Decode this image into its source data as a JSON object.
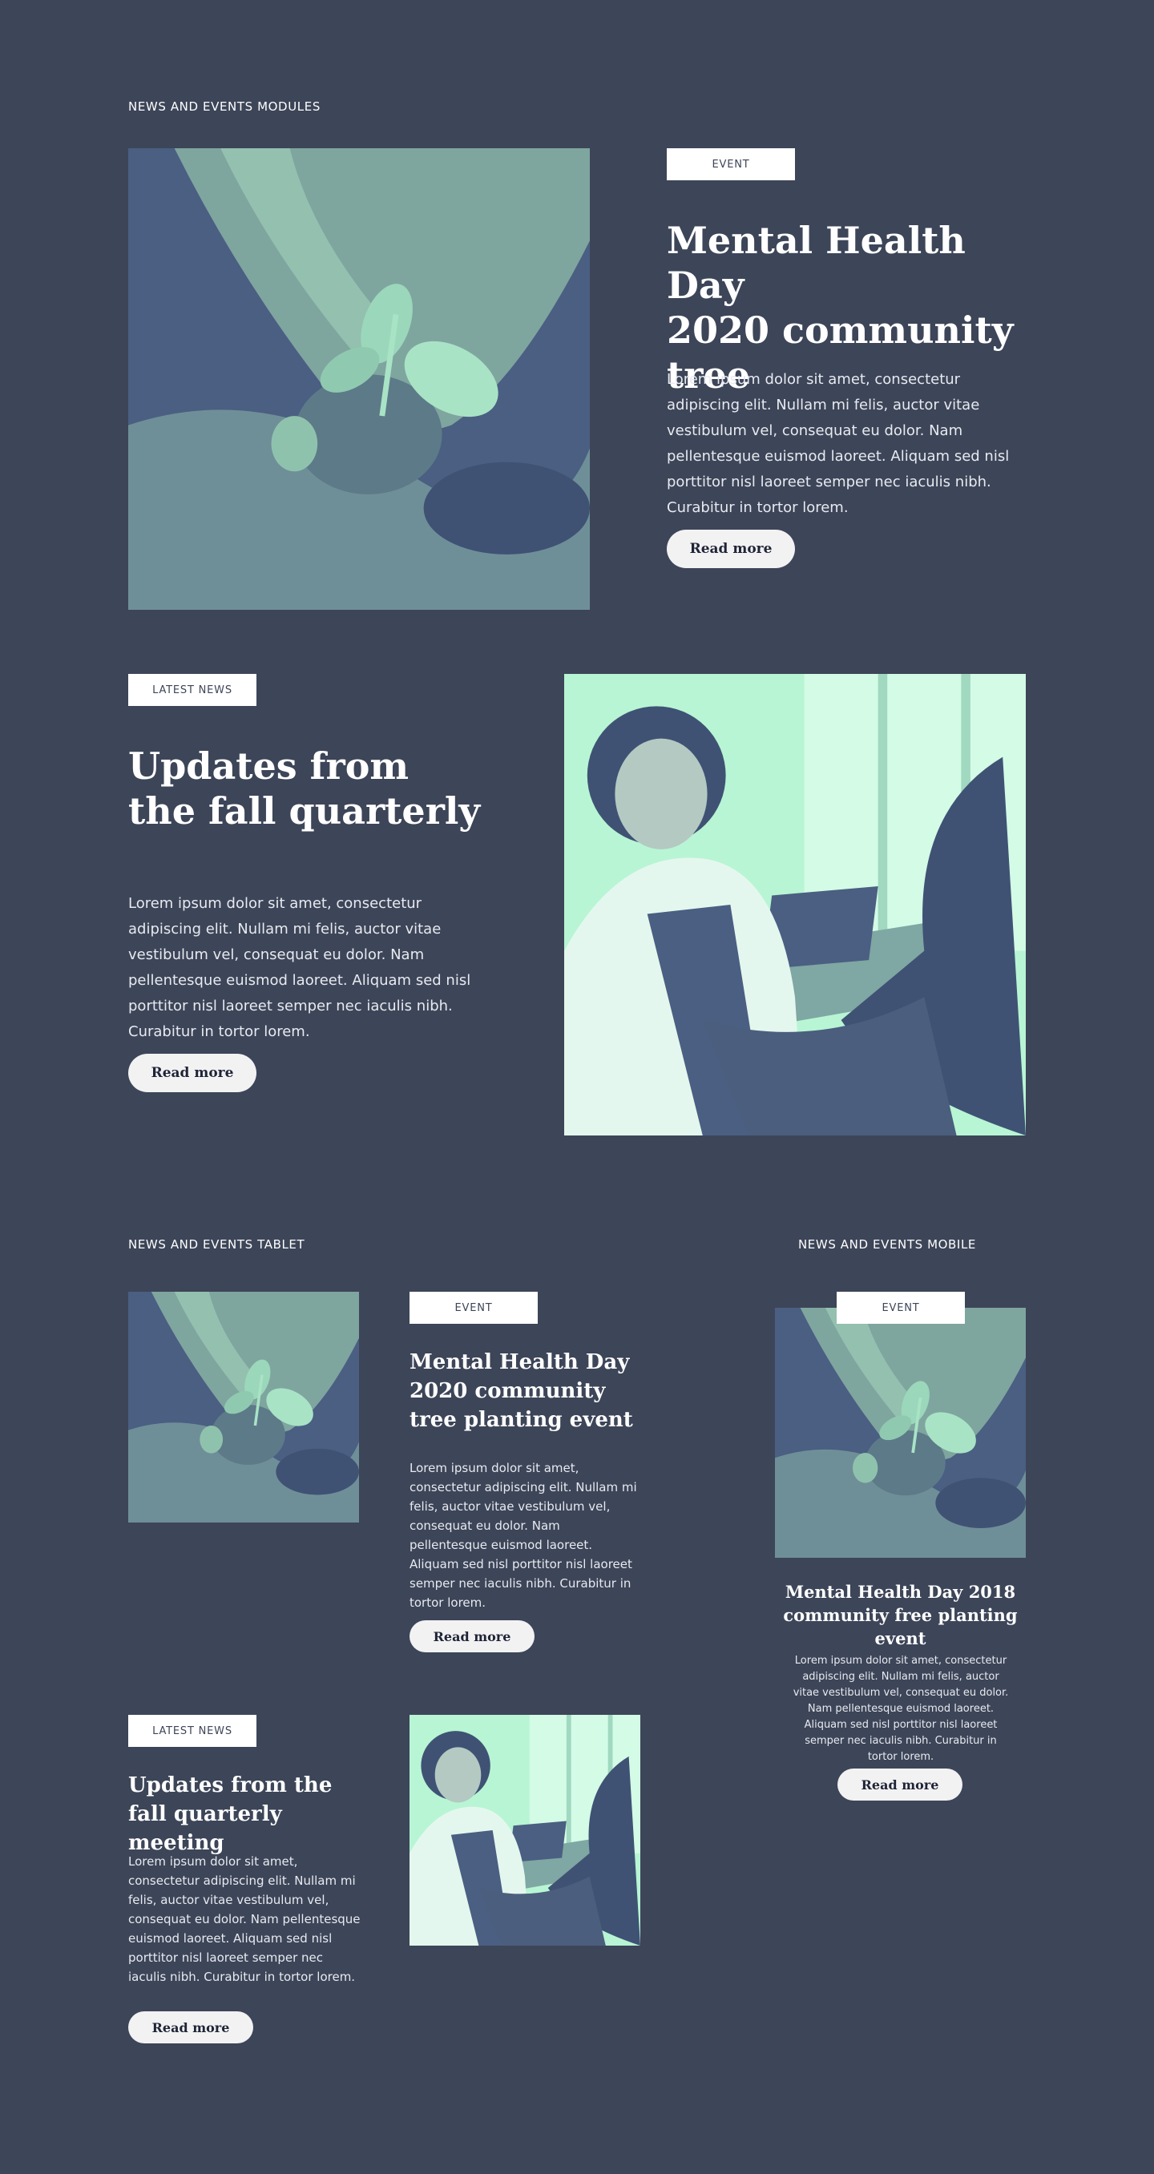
{
  "sections": {
    "desktop": "NEWS AND EVENTS MODULES",
    "tablet": "NEWS AND EVENTS TABLET",
    "mobile": "NEWS AND EVENTS MOBILE"
  },
  "desktop_event": {
    "tag": "EVENT",
    "title_line1": "Mental Health Day",
    "title_line2": "2020 community tree",
    "body": "Lorem ipsum dolor sit amet, consectetur adipiscing elit. Nullam mi felis, auctor vitae vestibulum vel, consequat eu dolor. Nam pellentesque euismod laoreet. Aliquam sed nisl porttitor nisl laoreet semper nec iaculis nibh. Curabitur in tortor lorem.",
    "button": "Read more"
  },
  "desktop_news": {
    "tag": "LATEST NEWS",
    "title_line1": "Updates from",
    "title_line2": "the fall quarterly",
    "body": "Lorem ipsum dolor sit amet, consectetur adipiscing elit. Nullam mi felis, auctor vitae vestibulum vel, consequat eu dolor. Nam pellentesque euismod laoreet. Aliquam sed nisl porttitor nisl laoreet semper nec iaculis nibh. Curabitur in tortor lorem.",
    "button": "Read more"
  },
  "tablet_event": {
    "tag": "EVENT",
    "title": "Mental Health Day 2020 community tree planting event",
    "body": "Lorem ipsum dolor sit amet, consectetur adipiscing elit. Nullam mi felis, auctor vitae vestibulum vel, consequat eu dolor. Nam pellentesque euismod laoreet. Aliquam sed nisl porttitor nisl laoreet semper nec iaculis nibh. Curabitur in tortor lorem.",
    "button": "Read more"
  },
  "tablet_news": {
    "tag": "LATEST NEWS",
    "title": "Updates from the fall quarterly meeting",
    "body": "Lorem ipsum dolor sit amet, consectetur adipiscing elit. Nullam mi felis, auctor vitae vestibulum vel, consequat eu dolor. Nam pellentesque euismod laoreet. Aliquam sed nisl porttitor nisl laoreet semper nec iaculis nibh. Curabitur in tortor lorem.",
    "button": "Read more"
  },
  "mobile_event": {
    "tag": "EVENT",
    "title": "Mental Health Day 2018 community free planting event",
    "body": "Lorem ipsum dolor sit amet, consectetur adipiscing elit. Nullam mi felis, auctor vitae vestibulum vel, consequat eu dolor. Nam pellentesque euismod laoreet. Aliquam sed nisl porttitor nisl laoreet semper nec iaculis nibh. Curabitur in tortor lorem.",
    "button": "Read more"
  },
  "colors": {
    "background": "#3d4558",
    "tag_bg": "#ffffff",
    "button_bg": "#f2f2f3",
    "image_dark": "#3d4f72",
    "image_light": "#b8f5d4"
  },
  "images": {
    "plant": "plant-in-hands-photo",
    "meeting": "business-meeting-photo"
  }
}
